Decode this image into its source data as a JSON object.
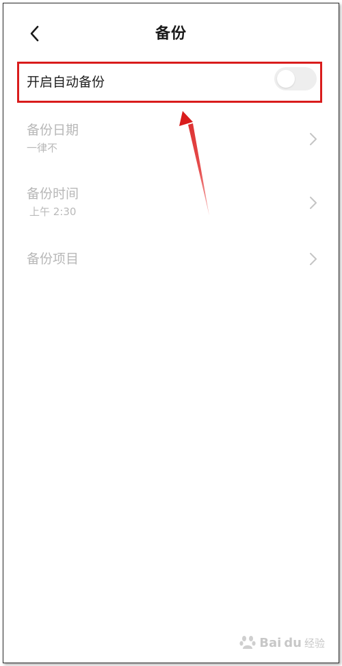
{
  "header": {
    "title": "备份",
    "back_icon": "chevron-left-icon"
  },
  "auto_backup": {
    "label": "开启自动备份",
    "enabled": false
  },
  "settings": {
    "date": {
      "label": "备份日期",
      "value": "一律不",
      "icon": "chevron-right-icon"
    },
    "time": {
      "label": "备份时间",
      "value": "上午 2:30",
      "icon": "chevron-right-icon"
    },
    "items": {
      "label": "备份项目",
      "icon": "chevron-right-icon"
    }
  },
  "annotation": {
    "highlight_color": "#d91c1c",
    "arrow_color": "#d91c1c"
  },
  "watermark": {
    "brand": "Bai",
    "brand2": "du",
    "suffix": "经验"
  },
  "colors": {
    "title": "#1a1a1a",
    "active_text": "#1f1f1f",
    "disabled_text": "#b7b7b7",
    "toggle_off": "#eeeeee"
  }
}
